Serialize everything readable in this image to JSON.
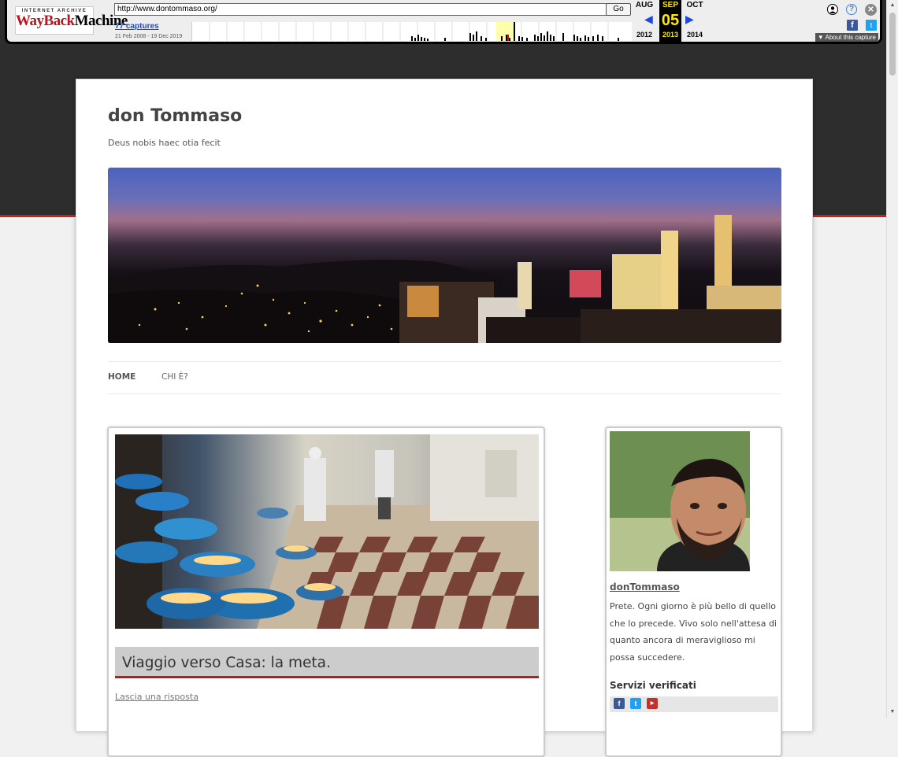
{
  "wayback": {
    "logo_top": "INTERNET ARCHIVE",
    "logo_wayback": "WayBack",
    "logo_machine": "Machine",
    "url": "http://www.dontommaso.org/",
    "go_label": "Go",
    "captures": "77 captures",
    "range": "21 Feb 2008 - 19 Dec 2019",
    "months": {
      "prev": "AUG",
      "current": "SEP",
      "next": "OCT"
    },
    "years": {
      "prev": "2012",
      "current": "2013",
      "next": "2014"
    },
    "day": "05",
    "about": "▼ About this capture"
  },
  "site": {
    "title": "don Tommaso",
    "description": "Deus nobis haec otia fecit"
  },
  "nav": {
    "items": [
      "HOME",
      "CHI È?"
    ]
  },
  "post": {
    "title": "Viaggio verso Casa: la meta.",
    "reply": "Lascia una risposta"
  },
  "sidebar": {
    "name": "donTommaso",
    "bio": "Prete. Ogni giorno è più bello di quello che lo precede. Vivo solo nell'attesa di quanto ancora di meraviglioso mi possa succedere.",
    "services_heading": "Servizi verificati"
  },
  "colors": {
    "accent_red": "#c41818",
    "dark_bg": "#2d2d2d",
    "wayback_blue": "#1a4ad6",
    "wayback_yellow": "#ffea00"
  }
}
